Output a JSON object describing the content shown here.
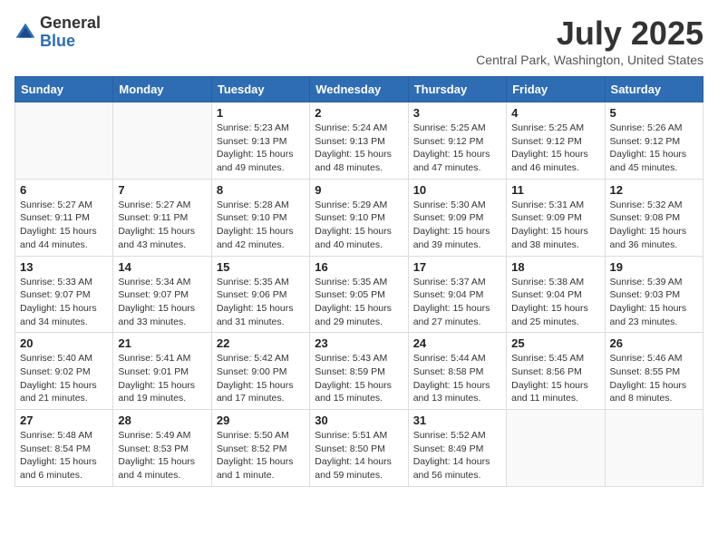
{
  "header": {
    "logo_general": "General",
    "logo_blue": "Blue",
    "month_title": "July 2025",
    "location": "Central Park, Washington, United States"
  },
  "days_of_week": [
    "Sunday",
    "Monday",
    "Tuesday",
    "Wednesday",
    "Thursday",
    "Friday",
    "Saturday"
  ],
  "weeks": [
    [
      {
        "day": "",
        "info": ""
      },
      {
        "day": "",
        "info": ""
      },
      {
        "day": "1",
        "info": "Sunrise: 5:23 AM\nSunset: 9:13 PM\nDaylight: 15 hours\nand 49 minutes."
      },
      {
        "day": "2",
        "info": "Sunrise: 5:24 AM\nSunset: 9:13 PM\nDaylight: 15 hours\nand 48 minutes."
      },
      {
        "day": "3",
        "info": "Sunrise: 5:25 AM\nSunset: 9:12 PM\nDaylight: 15 hours\nand 47 minutes."
      },
      {
        "day": "4",
        "info": "Sunrise: 5:25 AM\nSunset: 9:12 PM\nDaylight: 15 hours\nand 46 minutes."
      },
      {
        "day": "5",
        "info": "Sunrise: 5:26 AM\nSunset: 9:12 PM\nDaylight: 15 hours\nand 45 minutes."
      }
    ],
    [
      {
        "day": "6",
        "info": "Sunrise: 5:27 AM\nSunset: 9:11 PM\nDaylight: 15 hours\nand 44 minutes."
      },
      {
        "day": "7",
        "info": "Sunrise: 5:27 AM\nSunset: 9:11 PM\nDaylight: 15 hours\nand 43 minutes."
      },
      {
        "day": "8",
        "info": "Sunrise: 5:28 AM\nSunset: 9:10 PM\nDaylight: 15 hours\nand 42 minutes."
      },
      {
        "day": "9",
        "info": "Sunrise: 5:29 AM\nSunset: 9:10 PM\nDaylight: 15 hours\nand 40 minutes."
      },
      {
        "day": "10",
        "info": "Sunrise: 5:30 AM\nSunset: 9:09 PM\nDaylight: 15 hours\nand 39 minutes."
      },
      {
        "day": "11",
        "info": "Sunrise: 5:31 AM\nSunset: 9:09 PM\nDaylight: 15 hours\nand 38 minutes."
      },
      {
        "day": "12",
        "info": "Sunrise: 5:32 AM\nSunset: 9:08 PM\nDaylight: 15 hours\nand 36 minutes."
      }
    ],
    [
      {
        "day": "13",
        "info": "Sunrise: 5:33 AM\nSunset: 9:07 PM\nDaylight: 15 hours\nand 34 minutes."
      },
      {
        "day": "14",
        "info": "Sunrise: 5:34 AM\nSunset: 9:07 PM\nDaylight: 15 hours\nand 33 minutes."
      },
      {
        "day": "15",
        "info": "Sunrise: 5:35 AM\nSunset: 9:06 PM\nDaylight: 15 hours\nand 31 minutes."
      },
      {
        "day": "16",
        "info": "Sunrise: 5:35 AM\nSunset: 9:05 PM\nDaylight: 15 hours\nand 29 minutes."
      },
      {
        "day": "17",
        "info": "Sunrise: 5:37 AM\nSunset: 9:04 PM\nDaylight: 15 hours\nand 27 minutes."
      },
      {
        "day": "18",
        "info": "Sunrise: 5:38 AM\nSunset: 9:04 PM\nDaylight: 15 hours\nand 25 minutes."
      },
      {
        "day": "19",
        "info": "Sunrise: 5:39 AM\nSunset: 9:03 PM\nDaylight: 15 hours\nand 23 minutes."
      }
    ],
    [
      {
        "day": "20",
        "info": "Sunrise: 5:40 AM\nSunset: 9:02 PM\nDaylight: 15 hours\nand 21 minutes."
      },
      {
        "day": "21",
        "info": "Sunrise: 5:41 AM\nSunset: 9:01 PM\nDaylight: 15 hours\nand 19 minutes."
      },
      {
        "day": "22",
        "info": "Sunrise: 5:42 AM\nSunset: 9:00 PM\nDaylight: 15 hours\nand 17 minutes."
      },
      {
        "day": "23",
        "info": "Sunrise: 5:43 AM\nSunset: 8:59 PM\nDaylight: 15 hours\nand 15 minutes."
      },
      {
        "day": "24",
        "info": "Sunrise: 5:44 AM\nSunset: 8:58 PM\nDaylight: 15 hours\nand 13 minutes."
      },
      {
        "day": "25",
        "info": "Sunrise: 5:45 AM\nSunset: 8:56 PM\nDaylight: 15 hours\nand 11 minutes."
      },
      {
        "day": "26",
        "info": "Sunrise: 5:46 AM\nSunset: 8:55 PM\nDaylight: 15 hours\nand 8 minutes."
      }
    ],
    [
      {
        "day": "27",
        "info": "Sunrise: 5:48 AM\nSunset: 8:54 PM\nDaylight: 15 hours\nand 6 minutes."
      },
      {
        "day": "28",
        "info": "Sunrise: 5:49 AM\nSunset: 8:53 PM\nDaylight: 15 hours\nand 4 minutes."
      },
      {
        "day": "29",
        "info": "Sunrise: 5:50 AM\nSunset: 8:52 PM\nDaylight: 15 hours\nand 1 minute."
      },
      {
        "day": "30",
        "info": "Sunrise: 5:51 AM\nSunset: 8:50 PM\nDaylight: 14 hours\nand 59 minutes."
      },
      {
        "day": "31",
        "info": "Sunrise: 5:52 AM\nSunset: 8:49 PM\nDaylight: 14 hours\nand 56 minutes."
      },
      {
        "day": "",
        "info": ""
      },
      {
        "day": "",
        "info": ""
      }
    ]
  ]
}
